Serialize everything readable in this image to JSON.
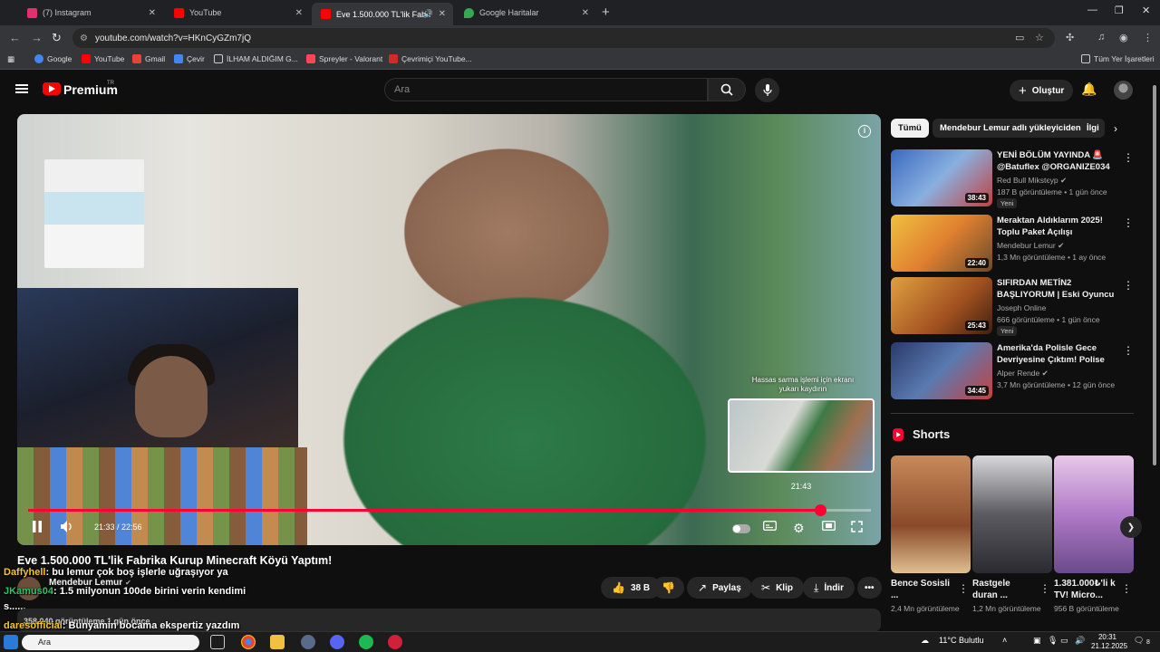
{
  "browser": {
    "tabs": [
      {
        "label": "(7) Instagram",
        "color": "#e1306c"
      },
      {
        "label": "YouTube",
        "color": "#ff0000"
      },
      {
        "label": "Eve 1.500.000 TL'lik Fabrika",
        "color": "#ff0000",
        "active": true
      },
      {
        "label": "Google Haritalar",
        "color": "#34a853"
      }
    ],
    "url": "youtube.com/watch?v=HKnCyGZm7jQ",
    "bookmarks": [
      "Google",
      "YouTube",
      "Gmail",
      "Çevir",
      "İLHAM ALDIĞIM G...",
      "Spreyler - Valorant",
      "Çevrimiçi YouTube..."
    ],
    "all_bookmarks": "Tüm Yer İşaretleri"
  },
  "header": {
    "brand": "Premium",
    "region": "TR",
    "search_placeholder": "Ara",
    "create_label": "Oluştur"
  },
  "player": {
    "time_current": "21:33",
    "time_total": "22:56",
    "time_display": "21:33 / 22:56",
    "progress": 0.94,
    "preview_time": "21:43",
    "seek_hint": "Hassas sarma işlemi için ekranı yukarı kaydırın"
  },
  "video": {
    "title": "Eve 1.500.000 TL'lik Fabrika Kurup Minecraft Köyü Yaptım!",
    "channel": "Mendebur Lemur",
    "likes": "38 B",
    "share_label": "Paylaş",
    "clip_label": "Klip",
    "download_label": "İndir",
    "stats": "358.040 görüntüleme  1 gün önce"
  },
  "chat": [
    {
      "nick": "Daffyhell",
      "text": ": bu lemur çok boş işlerle uğraşıyor ya",
      "nick_color": "#f7c91a"
    },
    {
      "nick": "JKamus04",
      "text": ": 1.5 milyonun 100de birini verin kendimi",
      "nick_color": "#29c36a"
    },
    {
      "nick": "",
      "text": "s......",
      "nick_color": "#ffffff"
    },
    {
      "nick": "daresofficial",
      "text": ": Bunyamin bocama ekspertiz yazdım",
      "nick_color": "#f7c91a"
    }
  ],
  "chips": [
    "Tümü",
    "Mendebur Lemur adlı yükleyiciden",
    "İlgi"
  ],
  "recommendations": [
    {
      "title": "YENİ BÖLÜM YAYINDA 🚨 @Batuflex @ORGANIZE034 ...",
      "channel": "Red Bull Mikstєyp ✔",
      "meta": "187 B görüntüleme • 1 gün önce",
      "duration": "38:43",
      "new": "Yeni",
      "thumb": "#5a8ac8"
    },
    {
      "title": "Meraktan Aldıklarım 2025! Toplu Paket Açılışı",
      "channel": "Mendebur Lemur ✔",
      "meta": "1,3 Mn görüntüleme • 1 ay önce",
      "duration": "22:40",
      "new": "",
      "thumb": "#d8a040"
    },
    {
      "title": "SIFIRDAN METİN2 BAŞLIYORUM | Eski Oyuncu ...",
      "channel": "Joseph Online",
      "meta": "666 görüntüleme • 1 gün önce",
      "duration": "25:43",
      "new": "Yeni",
      "thumb": "#c07030"
    },
    {
      "title": "Amerika'da Polisle Gece Devriyesine Çıktım! Polise Küf...",
      "channel": "Alper Rende ✔",
      "meta": "3,7 Mn görüntüleme • 12 gün önce",
      "duration": "34:45",
      "new": "",
      "thumb": "#3a5a9a"
    }
  ],
  "shorts": {
    "heading": "Shorts",
    "items": [
      {
        "title": "Bence Sosisli ...",
        "views": "2,4 Mn görüntüleme",
        "thumb": "#8a5a3a"
      },
      {
        "title": "Rastgele duran ...",
        "views": "1,2 Mn görüntüleme",
        "thumb": "#6a6a72"
      },
      {
        "title": "1.381.000₺'li k TV! Micro...",
        "views": "956 B görüntüleme",
        "thumb": "#c89ac8"
      }
    ]
  },
  "taskbar": {
    "search_text": "Ara",
    "weather": "11°C  Bulutlu",
    "time": "20:31",
    "date": "21.12.2025",
    "notif_count": "8"
  }
}
